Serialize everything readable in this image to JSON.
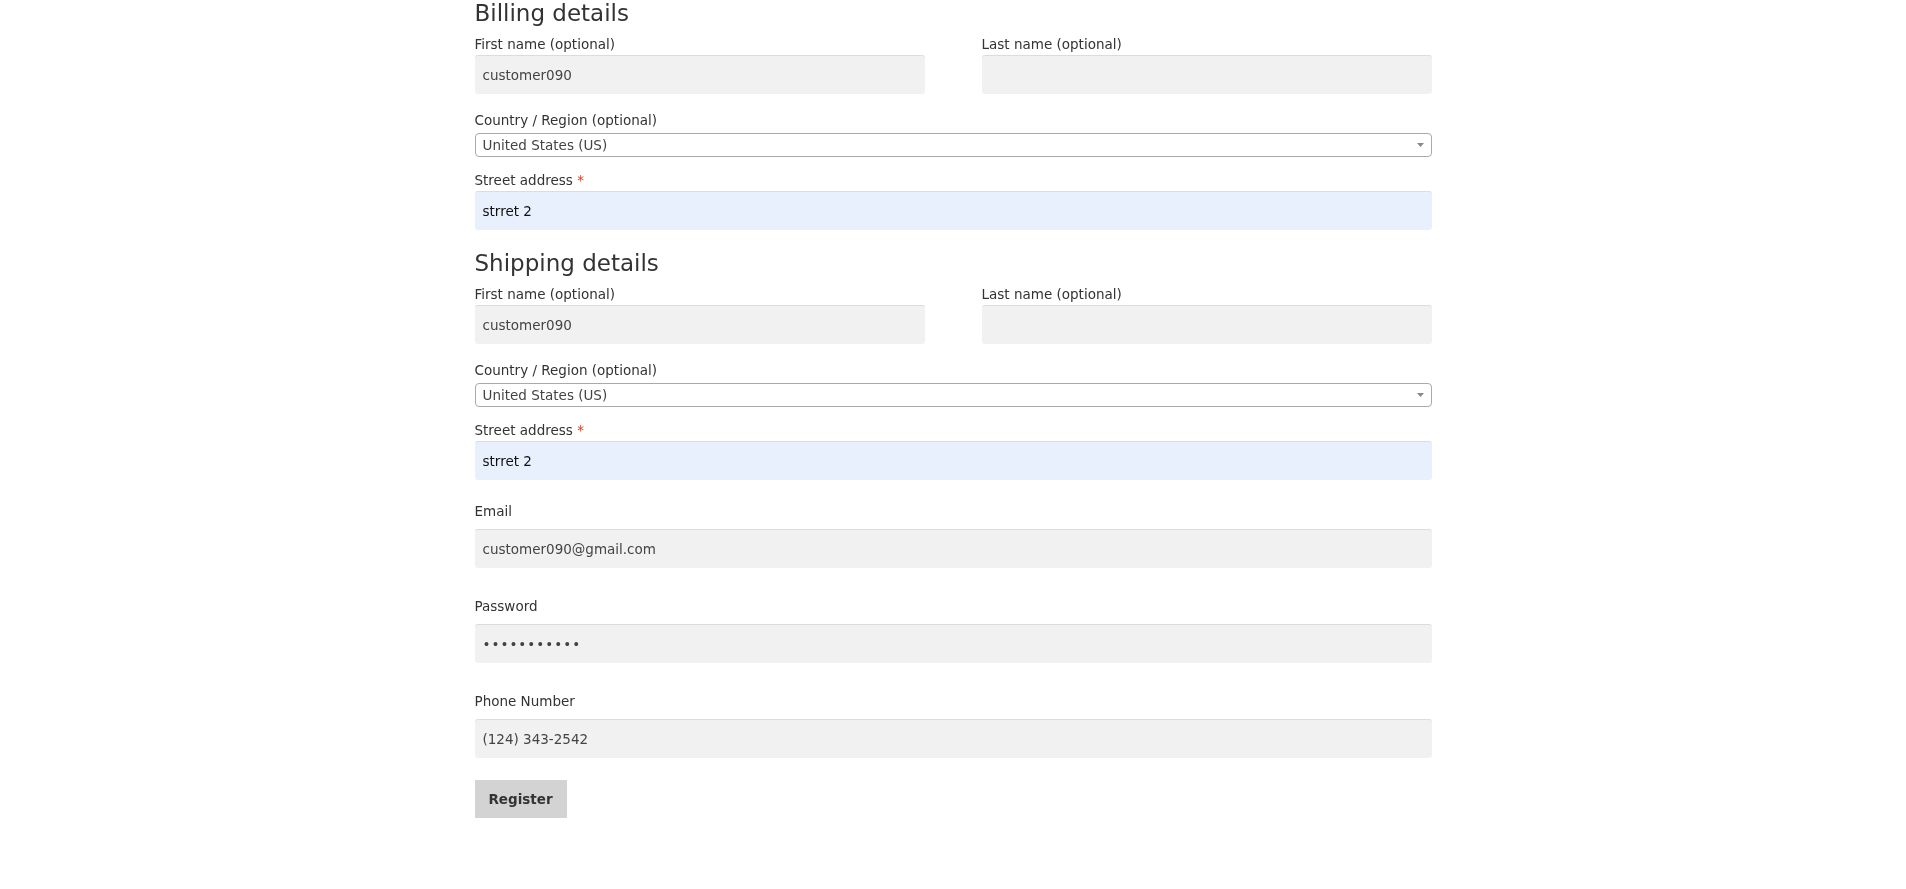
{
  "sections": [
    {
      "kind": "address",
      "title": "Billing details",
      "rows": [
        [
          {
            "kind": "text",
            "label": "First name (optional)",
            "value": "customer090",
            "autofilled": false
          },
          {
            "kind": "text",
            "label": "Last name (optional)",
            "autofilled": false
          }
        ],
        [
          {
            "kind": "select",
            "label": "Country / Region (optional)",
            "value": "United States (US)"
          }
        ],
        [
          {
            "kind": "text",
            "label": "Street address",
            "required_mark": "*",
            "value": "strret 2",
            "autofilled": true
          }
        ]
      ]
    },
    {
      "kind": "address",
      "title": "Shipping details",
      "rows": [
        [
          {
            "kind": "text",
            "label": "First name (optional)",
            "value": "customer090",
            "autofilled": false
          },
          {
            "kind": "text",
            "label": "Last name (optional)",
            "autofilled": false
          }
        ],
        [
          {
            "kind": "select",
            "label": "Country / Region (optional)",
            "value": "United States (US)"
          }
        ],
        [
          {
            "kind": "text",
            "label": "Street address",
            "required_mark": "*",
            "value": "strret 2",
            "autofilled": true
          }
        ]
      ]
    },
    {
      "kind": "account",
      "rows": [
        [
          {
            "kind": "text",
            "label": "Email",
            "value": "customer090@gmail.com",
            "autofilled": false
          }
        ],
        [
          {
            "kind": "password",
            "label": "Password",
            "value": "•••••••••••",
            "autofilled": false
          }
        ],
        [
          {
            "kind": "text",
            "label": "Phone Number",
            "value": "(124) 343-2542",
            "autofilled": false
          }
        ]
      ]
    }
  ],
  "submit_button": "Register"
}
